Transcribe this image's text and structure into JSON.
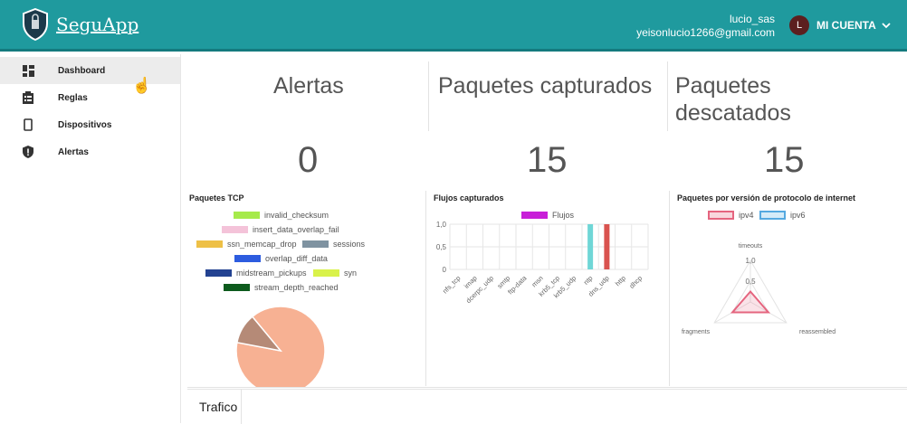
{
  "header": {
    "app_name": "SeguApp",
    "username": "lucio_sas",
    "email": "yeisonlucio1266@gmail.com",
    "avatar_letter": "L",
    "account_label": "MI CUENTA",
    "bar_color": "#1f9a9e"
  },
  "sidebar": {
    "items": [
      {
        "label": "Dashboard",
        "icon": "dashboard-icon",
        "active": true
      },
      {
        "label": "Reglas",
        "icon": "clipboard-icon",
        "active": false
      },
      {
        "label": "Dispositivos",
        "icon": "device-icon",
        "active": false
      },
      {
        "label": "Alertas",
        "icon": "shield-alert-icon",
        "active": false
      }
    ]
  },
  "stats": [
    {
      "title": "Alertas",
      "value": "0"
    },
    {
      "title": "Paquetes capturados",
      "value": "15"
    },
    {
      "title_line1": "Paquetes",
      "title_line2": "descatados",
      "value": "15"
    }
  ],
  "charts": {
    "tcp": {
      "title": "Paquetes TCP",
      "legend": [
        {
          "label": "invalid_checksum",
          "color": "#a6ea4b"
        },
        {
          "label": "insert_data_overlap_fail",
          "color": "#f4c3d9"
        },
        {
          "label": "ssn_memcap_drop",
          "color": "#eec046"
        },
        {
          "label": "sessions",
          "color": "#7f93a1"
        },
        {
          "label": "overlap_diff_data",
          "color": "#2d5cdf"
        },
        {
          "label": "midstream_pickups",
          "color": "#234291"
        },
        {
          "label": "syn",
          "color": "#d9f24a"
        },
        {
          "label": "stream_depth_reached",
          "color": "#0d5b1d"
        }
      ]
    },
    "flujos": {
      "title": "Flujos capturados",
      "legend_label": "Flujos",
      "legend_color": "#c81fd8",
      "y_ticks": [
        "1,0",
        "0,5",
        "0"
      ],
      "x_ticks": [
        "nfs_tcp",
        "imap",
        "dcerpc_udp",
        "smtp",
        "ftp-data",
        "msn",
        "krb5_tcp",
        "krb5_udp",
        "ntp",
        "dns_udp",
        "http",
        "dhcp"
      ]
    },
    "protocol": {
      "title": "Paquetes por versión de protocolo de internet",
      "legend": [
        {
          "label": "ipv4",
          "color": "#e5657f"
        },
        {
          "label": "ipv6",
          "color": "#55a9e0"
        }
      ],
      "axis_labels": [
        "timeouts",
        "fragments",
        "reassembled"
      ],
      "scale_ticks": [
        "1,0",
        "0,5"
      ]
    }
  },
  "chart_data": [
    {
      "type": "pie",
      "title": "Paquetes TCP",
      "categories": [
        "invalid_checksum",
        "insert_data_overlap_fail",
        "ssn_memcap_drop",
        "sessions",
        "overlap_diff_data",
        "midstream_pickups",
        "syn",
        "stream_depth_reached"
      ],
      "slices": [
        {
          "label": "",
          "value": 0.89,
          "color": "#f7b193"
        },
        {
          "label": "",
          "value": 0.11,
          "color": "#b58a77"
        }
      ]
    },
    {
      "type": "bar",
      "title": "Flujos capturados",
      "series": [
        {
          "name": "Flujos",
          "values": [
            0,
            0,
            0,
            0,
            0,
            0,
            0,
            0,
            1,
            1,
            0,
            0
          ]
        }
      ],
      "categories": [
        "nfs_tcp",
        "imap",
        "dcerpc_udp",
        "smtp",
        "ftp-data",
        "msn",
        "krb5_tcp",
        "krb5_udp",
        "ntp",
        "dns_udp",
        "http",
        "dhcp"
      ],
      "bar_colors": {
        "ntp": "#6fd6d6",
        "dns_udp": "#d9534f"
      },
      "ylim": [
        0,
        1.0
      ]
    },
    {
      "type": "radar",
      "title": "Paquetes por versión de protocolo de internet",
      "axes": [
        "timeouts",
        "reassembled",
        "fragments"
      ],
      "series": [
        {
          "name": "ipv4",
          "values": [
            0.25,
            0.5,
            0.5
          ]
        },
        {
          "name": "ipv6",
          "values": [
            0,
            0,
            0
          ]
        }
      ],
      "rlim": [
        0,
        1.0
      ]
    }
  ]
}
